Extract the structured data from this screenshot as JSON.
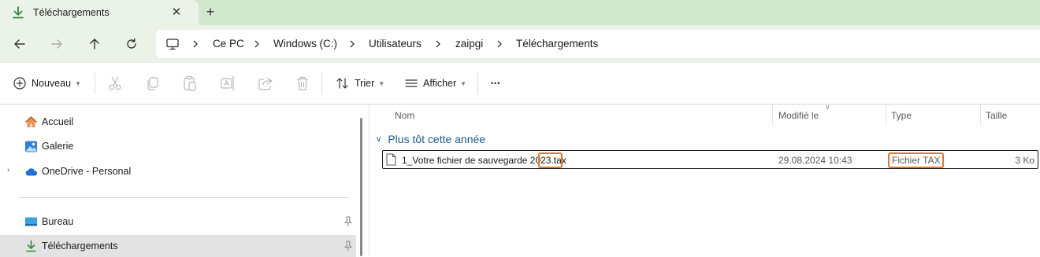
{
  "tab": {
    "title": "Téléchargements",
    "close_glyph": "✕",
    "new_glyph": "+"
  },
  "nav": {
    "back_icon": "arrow-left-icon",
    "forward_icon": "arrow-right-icon",
    "up_icon": "arrow-up-icon",
    "refresh_icon": "refresh-icon"
  },
  "breadcrumb": [
    "Ce PC",
    "Windows (C:)",
    "Utilisateurs",
    "zaipgi",
    "Téléchargements"
  ],
  "toolbar": {
    "new_label": "Nouveau",
    "sort_label": "Trier",
    "view_label": "Afficher",
    "more_glyph": "•••"
  },
  "sidebar": {
    "items": [
      {
        "label": "Accueil",
        "icon": "home-icon"
      },
      {
        "label": "Galerie",
        "icon": "gallery-icon"
      },
      {
        "label": "OneDrive - Personal",
        "icon": "cloud-icon"
      },
      {
        "label": "Bureau",
        "icon": "desktop-icon"
      },
      {
        "label": "Téléchargements",
        "icon": "download-icon"
      }
    ],
    "expander_glyph": "›"
  },
  "columns": {
    "name": "Nom",
    "modified": "Modifié le",
    "type": "Type",
    "size": "Taille"
  },
  "group": {
    "label": "Plus tôt cette année",
    "chevron": "∨"
  },
  "files": [
    {
      "name": "1_Votre fichier de sauvegarde 2023.tax",
      "modified": "29.08.2024 10:43",
      "type": "Fichier TAX",
      "size": "3 Ko"
    }
  ],
  "colors": {
    "tab_bar": "#d1e8cf",
    "tab_active": "#ebf3e9",
    "highlight": "#e8762a",
    "group_label": "#1e5b8c",
    "selected_nav": "#e3e3e3"
  }
}
